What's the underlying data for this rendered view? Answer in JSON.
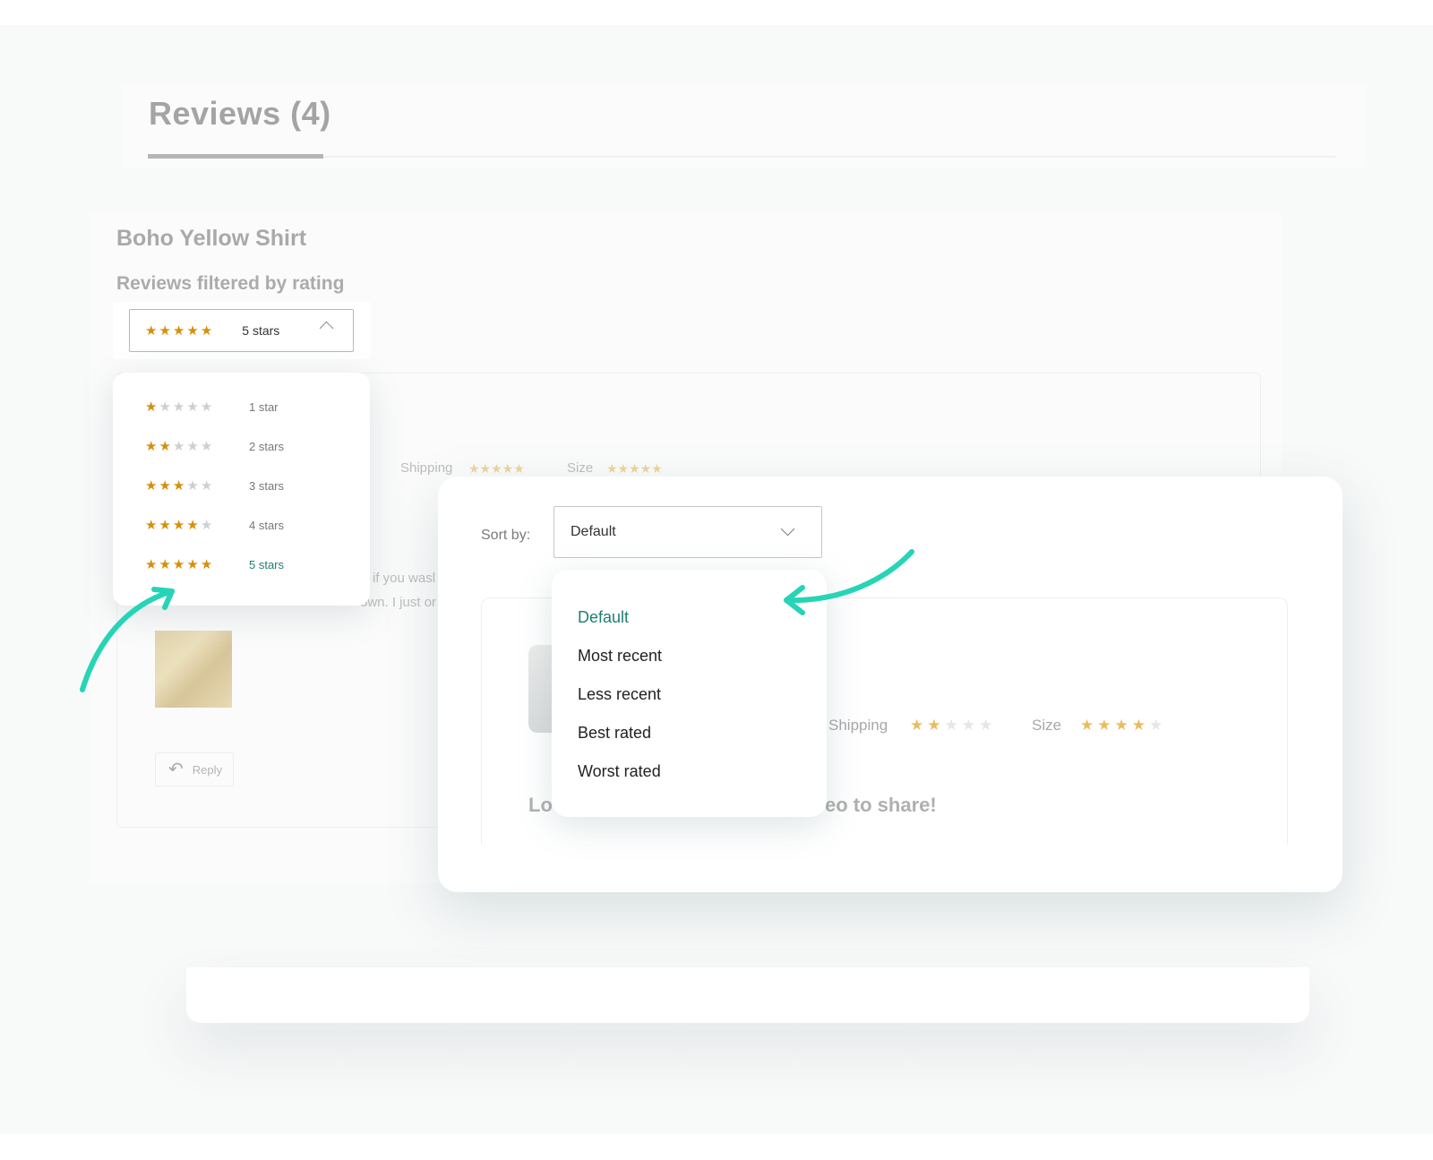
{
  "header": {
    "tab_title": "Reviews (4)"
  },
  "product": {
    "title": "Boho Yellow Shirt"
  },
  "rating_filter": {
    "label": "Reviews filtered by rating",
    "selected_label": "5 stars",
    "selected_stars": 5,
    "options": [
      {
        "label": "1 star",
        "stars": 1
      },
      {
        "label": "2 stars",
        "stars": 2
      },
      {
        "label": "3 stars",
        "stars": 3
      },
      {
        "label": "4 stars",
        "stars": 4
      },
      {
        "label": "5 stars",
        "stars": 5
      }
    ]
  },
  "background_review": {
    "shipping_label": "Shipping",
    "size_label": "Size",
    "text_line1": "if you wasl",
    "text_line2": "own. I just or",
    "reply_label": "Reply"
  },
  "sort": {
    "label": "Sort by:",
    "selected": "Default",
    "options": [
      "Default",
      "Most recent",
      "Less recent",
      "Best rated",
      "Worst rated"
    ]
  },
  "inner_review": {
    "shipping_label": "Shipping",
    "shipping_stars": 2,
    "size_label": "Size",
    "size_stars": 4,
    "headline_start": "Lo",
    "headline_end": "eo to share!"
  },
  "colors": {
    "accent": "#1f7f74",
    "star": "#d68f0c",
    "arrow": "#26d4b6"
  }
}
